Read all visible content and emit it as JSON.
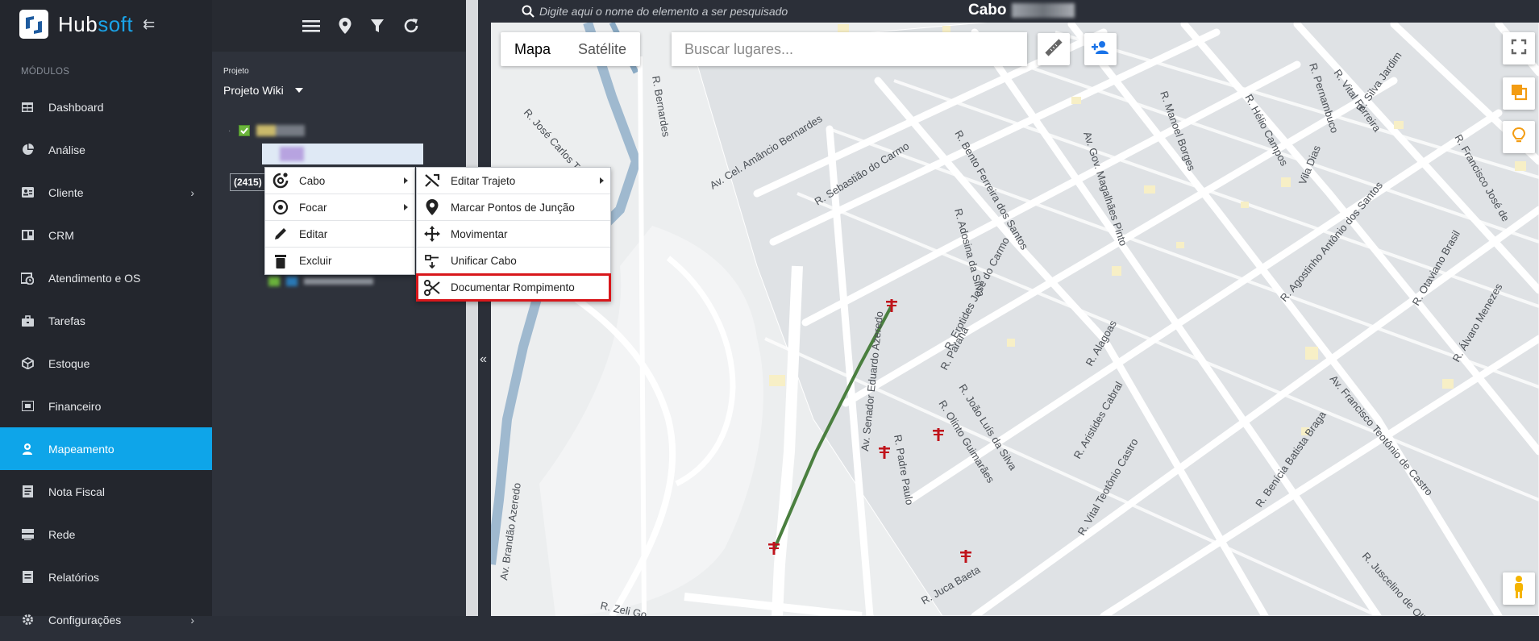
{
  "app": {
    "brand_main": "Hub",
    "brand_accent": "soft"
  },
  "sidebar": {
    "section_label": "MÓDULOS",
    "items": [
      {
        "label": "Dashboard",
        "icon": "table-icon"
      },
      {
        "label": "Análise",
        "icon": "pie-chart-icon"
      },
      {
        "label": "Cliente",
        "icon": "id-card-icon",
        "has_submenu": true
      },
      {
        "label": "CRM",
        "icon": "board-icon"
      },
      {
        "label": "Atendimento e OS",
        "icon": "calendar-clock-icon"
      },
      {
        "label": "Tarefas",
        "icon": "briefcase-icon"
      },
      {
        "label": "Estoque",
        "icon": "cube-icon"
      },
      {
        "label": "Financeiro",
        "icon": "money-icon"
      },
      {
        "label": "Mapeamento",
        "icon": "map-pin-user-icon",
        "active": true
      },
      {
        "label": "Nota Fiscal",
        "icon": "document-icon"
      },
      {
        "label": "Rede",
        "icon": "server-icon"
      },
      {
        "label": "Relatórios",
        "icon": "report-icon"
      },
      {
        "label": "Configurações",
        "icon": "gear-icon",
        "has_submenu": true
      }
    ]
  },
  "panel": {
    "toolbar_icons": [
      "menu-icon",
      "location-pin-icon",
      "filter-icon",
      "refresh-icon"
    ],
    "project_label": "Projeto",
    "project_value": "Projeto Wiki",
    "tree_count": "(2415)"
  },
  "context_menu": {
    "main": [
      {
        "label": "Cabo",
        "icon": "cable-icon",
        "submenu": true
      },
      {
        "label": "Focar",
        "icon": "target-icon",
        "submenu": true
      },
      {
        "label": "Editar",
        "icon": "pencil-icon"
      },
      {
        "label": "Excluir",
        "icon": "trash-icon"
      }
    ],
    "sub": [
      {
        "label": "Editar Trajeto",
        "icon": "route-icon",
        "submenu": true
      },
      {
        "label": "Marcar Pontos de Junção",
        "icon": "map-marker-icon"
      },
      {
        "label": "Movimentar",
        "icon": "move-icon"
      },
      {
        "label": "Unificar Cabo",
        "icon": "merge-icon"
      },
      {
        "label": "Documentar Rompimento",
        "icon": "scissors-icon",
        "highlighted": true
      }
    ]
  },
  "map": {
    "search_placeholder": "Digite aqui o nome do elemento a ser pesquisado",
    "cable_title": "Cabo",
    "type_map": "Mapa",
    "type_satellite": "Satélite",
    "places_placeholder": "Buscar lugares...",
    "street_labels": [
      "R. José Carlos Tavares",
      "R. Bernardes",
      "Av. Cel. Amâncio Bernardes",
      "R. Sebastião do Carmo",
      "R. Bento Ferreira dos Santos",
      "Av. Gov. Magalhães Pinto",
      "R. Manoel Borges",
      "R. Hélio Campos",
      "R. Vital Ferreira",
      "R. Silva Jardim",
      "R. Pernambuco",
      "Vila Dias",
      "R. Francisco José de",
      "R. Adosina da Silva",
      "R. Erotides José do Carmo",
      "R. Paraná",
      "R. Alagoas",
      "R. Agostinho Antônio dos Santos",
      "R. Otaviano Brasil",
      "R. Álvaro Menezes",
      "Av. Senador Eduardo Azeredo",
      "R. Olinto Guimarães",
      "R. João Luís da Silva",
      "R. Aristides Cabral",
      "R. Vital Teotônio Castro",
      "Av. Francisco Teotônio de Castro",
      "R. Benícia Batista Braga",
      "R. Padre Paulo",
      "R. Juca Baeta",
      "R. Zeli Go",
      "R. Juscelino de Oliveira",
      "Av. Brandão Azeredo"
    ]
  },
  "colors": {
    "accent": "#0ea5e9",
    "cable": "#4a7f3f",
    "pole": "#c0141c",
    "highlight": "#d8171b"
  }
}
